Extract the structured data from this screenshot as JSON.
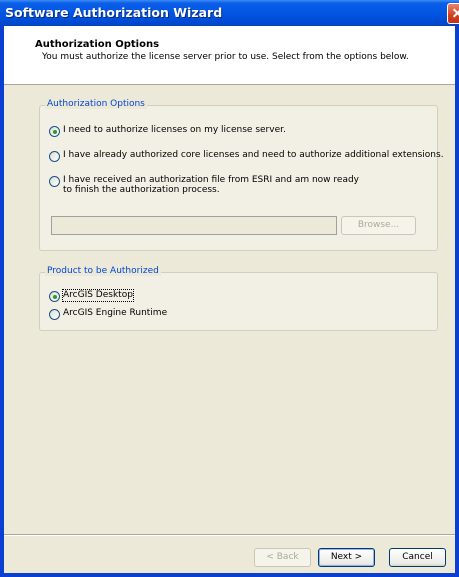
{
  "window": {
    "title": "Software Authorization Wizard"
  },
  "header": {
    "title": "Authorization Options",
    "description": "You must authorize the license server prior to use. Select from the options below."
  },
  "auth_options": {
    "legend": "Authorization Options",
    "options": [
      {
        "label": "I need to authorize licenses on my license server.",
        "checked": true
      },
      {
        "label": "I have already authorized core licenses and need to authorize additional extensions.",
        "checked": false
      },
      {
        "label": "I have received an authorization file from ESRI and am now ready to finish the authorization process.",
        "checked": false
      }
    ],
    "file_path": "",
    "browse_label": "Browse..."
  },
  "product": {
    "legend": "Product to be Authorized",
    "options": [
      {
        "label": "ArcGIS Desktop",
        "checked": true
      },
      {
        "label": "ArcGIS Engine Runtime",
        "checked": false
      }
    ]
  },
  "footer": {
    "back_label": "< Back",
    "next_label": "Next >",
    "cancel_label": "Cancel"
  }
}
